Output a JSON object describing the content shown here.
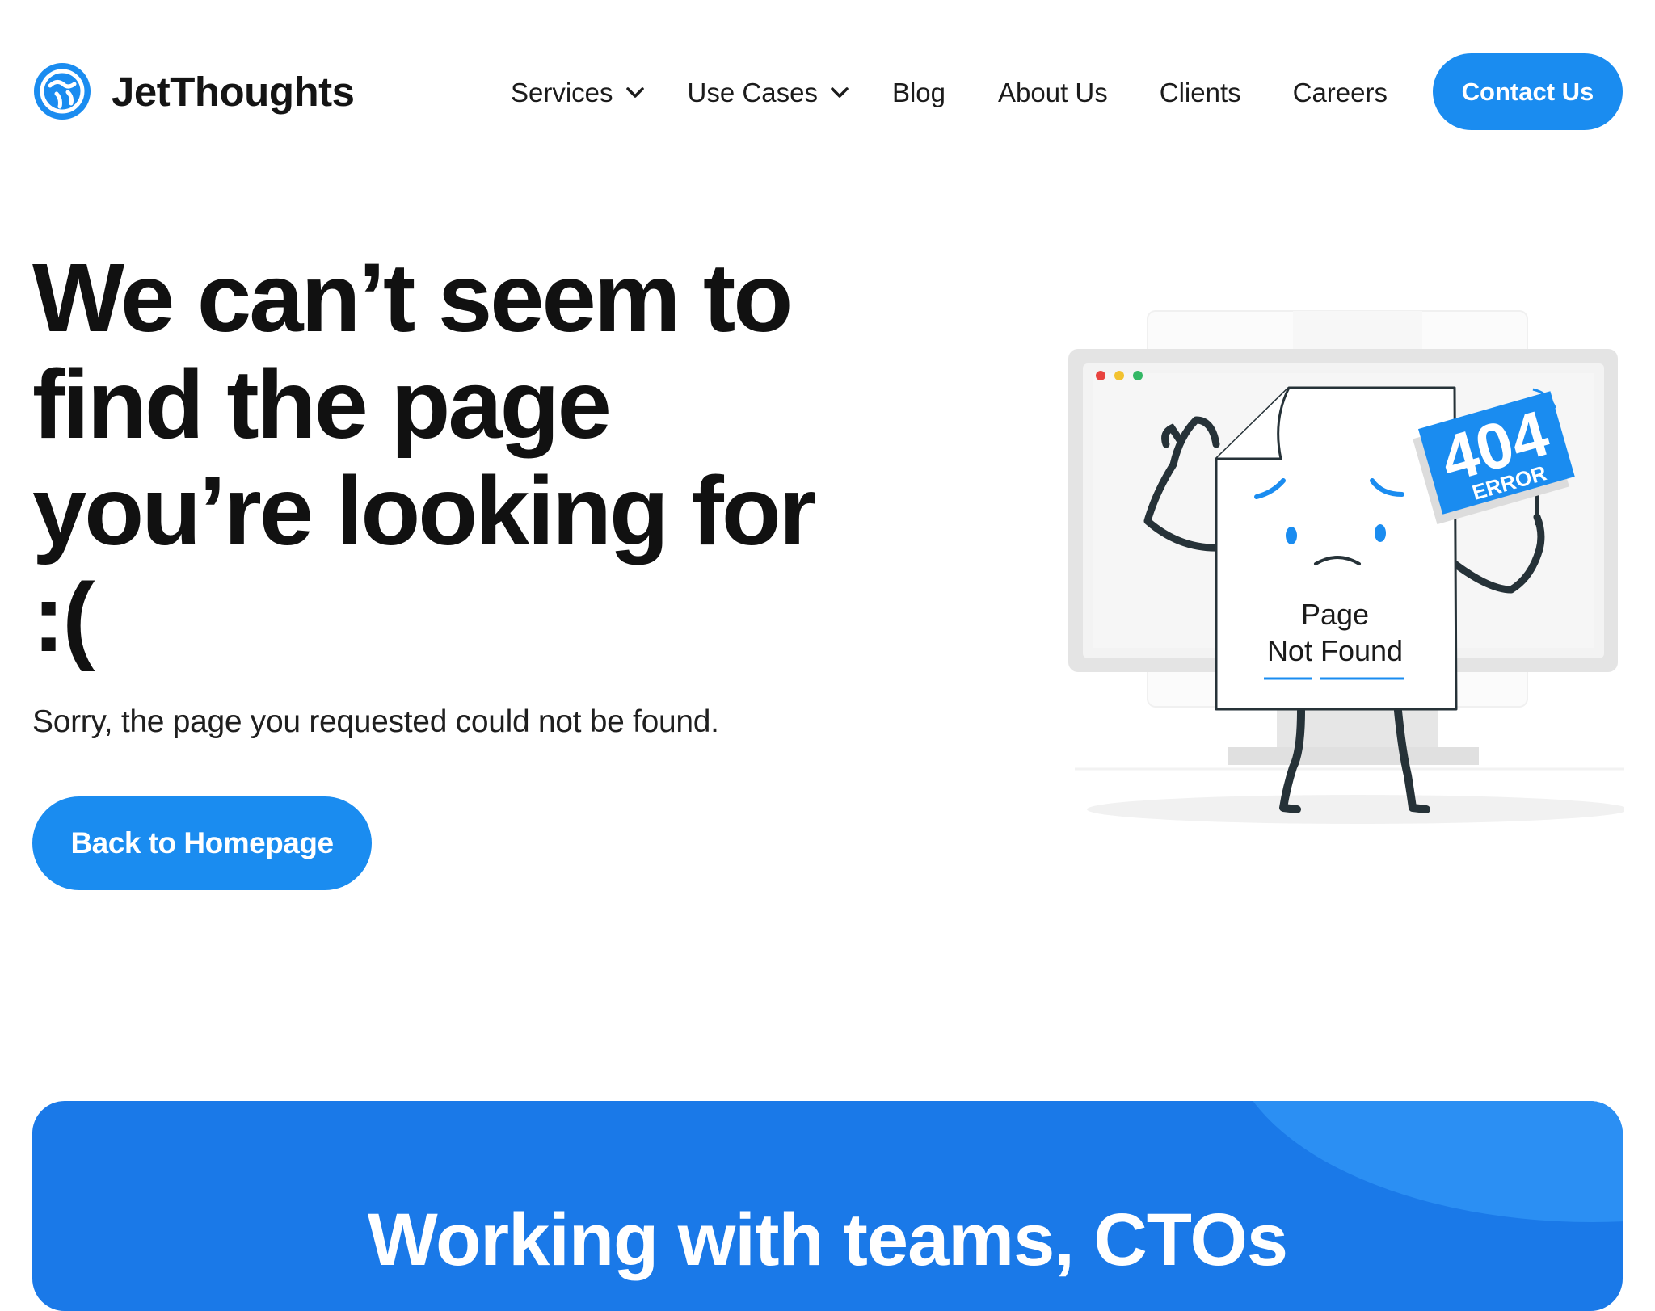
{
  "header": {
    "logo_text": "JetThoughts",
    "logo_icon": "globe-logo-icon",
    "nav": {
      "services": "Services",
      "use_cases": "Use Cases",
      "blog": "Blog",
      "about": "About Us",
      "clients": "Clients",
      "careers": "Careers"
    },
    "contact_label": "Contact Us"
  },
  "hero": {
    "title_lines": [
      "We can’t seem to",
      "find the page",
      "you’re looking for",
      ":("
    ],
    "subtitle": "Sorry, the page you requested could not be found.",
    "button_label": "Back to Homepage"
  },
  "illustration": {
    "sign_code": "404",
    "sign_label": "ERROR",
    "page_line1": "Page",
    "page_line2": "Not Found"
  },
  "banner": {
    "title": "Working with teams, CTOs"
  },
  "colors": {
    "brand_blue": "#1a8cf0",
    "banner_blue": "#1a79e8",
    "text_dark": "#111111"
  }
}
